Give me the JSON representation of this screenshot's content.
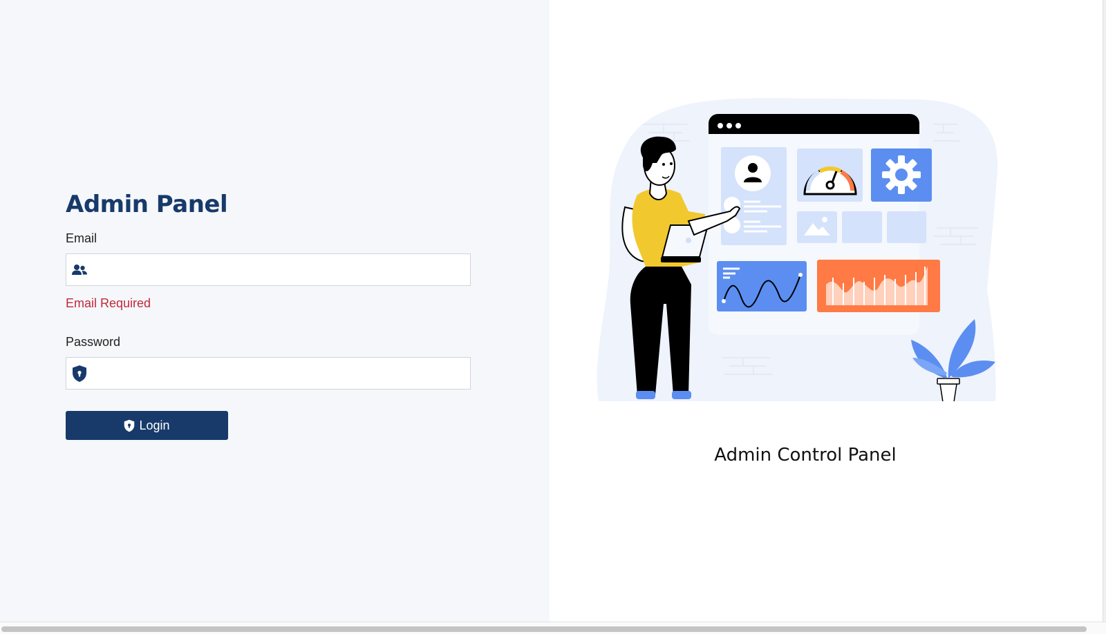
{
  "login_form": {
    "title": "Admin Panel",
    "email_label": "Email",
    "email_value": "",
    "email_error": "Email Required",
    "password_label": "Password",
    "password_value": "",
    "login_button_label": "Login",
    "email_icon": "users-icon",
    "password_icon": "shield-lock-icon",
    "button_icon": "shield-lock-icon"
  },
  "illustration": {
    "caption": "Admin Control Panel",
    "name": "admin-dashboard-illustration"
  },
  "colors": {
    "primary": "#173a6a",
    "error": "#c2283b",
    "left_background": "#f5f7fa",
    "accent_blue": "#5b8ef0",
    "accent_orange": "#ff7a45",
    "accent_yellow": "#f2c82f"
  }
}
